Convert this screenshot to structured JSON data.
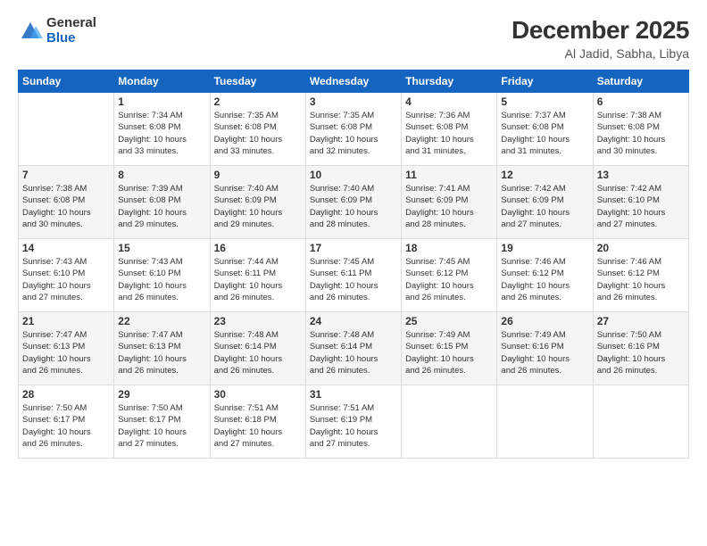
{
  "logo": {
    "general": "General",
    "blue": "Blue"
  },
  "title": {
    "month_year": "December 2025",
    "location": "Al Jadid, Sabha, Libya"
  },
  "days_of_week": [
    "Sunday",
    "Monday",
    "Tuesday",
    "Wednesday",
    "Thursday",
    "Friday",
    "Saturday"
  ],
  "weeks": [
    [
      {
        "day": "",
        "info": ""
      },
      {
        "day": "1",
        "info": "Sunrise: 7:34 AM\nSunset: 6:08 PM\nDaylight: 10 hours\nand 33 minutes."
      },
      {
        "day": "2",
        "info": "Sunrise: 7:35 AM\nSunset: 6:08 PM\nDaylight: 10 hours\nand 33 minutes."
      },
      {
        "day": "3",
        "info": "Sunrise: 7:35 AM\nSunset: 6:08 PM\nDaylight: 10 hours\nand 32 minutes."
      },
      {
        "day": "4",
        "info": "Sunrise: 7:36 AM\nSunset: 6:08 PM\nDaylight: 10 hours\nand 31 minutes."
      },
      {
        "day": "5",
        "info": "Sunrise: 7:37 AM\nSunset: 6:08 PM\nDaylight: 10 hours\nand 31 minutes."
      },
      {
        "day": "6",
        "info": "Sunrise: 7:38 AM\nSunset: 6:08 PM\nDaylight: 10 hours\nand 30 minutes."
      }
    ],
    [
      {
        "day": "7",
        "info": "Sunrise: 7:38 AM\nSunset: 6:08 PM\nDaylight: 10 hours\nand 30 minutes."
      },
      {
        "day": "8",
        "info": "Sunrise: 7:39 AM\nSunset: 6:08 PM\nDaylight: 10 hours\nand 29 minutes."
      },
      {
        "day": "9",
        "info": "Sunrise: 7:40 AM\nSunset: 6:09 PM\nDaylight: 10 hours\nand 29 minutes."
      },
      {
        "day": "10",
        "info": "Sunrise: 7:40 AM\nSunset: 6:09 PM\nDaylight: 10 hours\nand 28 minutes."
      },
      {
        "day": "11",
        "info": "Sunrise: 7:41 AM\nSunset: 6:09 PM\nDaylight: 10 hours\nand 28 minutes."
      },
      {
        "day": "12",
        "info": "Sunrise: 7:42 AM\nSunset: 6:09 PM\nDaylight: 10 hours\nand 27 minutes."
      },
      {
        "day": "13",
        "info": "Sunrise: 7:42 AM\nSunset: 6:10 PM\nDaylight: 10 hours\nand 27 minutes."
      }
    ],
    [
      {
        "day": "14",
        "info": "Sunrise: 7:43 AM\nSunset: 6:10 PM\nDaylight: 10 hours\nand 27 minutes."
      },
      {
        "day": "15",
        "info": "Sunrise: 7:43 AM\nSunset: 6:10 PM\nDaylight: 10 hours\nand 26 minutes."
      },
      {
        "day": "16",
        "info": "Sunrise: 7:44 AM\nSunset: 6:11 PM\nDaylight: 10 hours\nand 26 minutes."
      },
      {
        "day": "17",
        "info": "Sunrise: 7:45 AM\nSunset: 6:11 PM\nDaylight: 10 hours\nand 26 minutes."
      },
      {
        "day": "18",
        "info": "Sunrise: 7:45 AM\nSunset: 6:12 PM\nDaylight: 10 hours\nand 26 minutes."
      },
      {
        "day": "19",
        "info": "Sunrise: 7:46 AM\nSunset: 6:12 PM\nDaylight: 10 hours\nand 26 minutes."
      },
      {
        "day": "20",
        "info": "Sunrise: 7:46 AM\nSunset: 6:12 PM\nDaylight: 10 hours\nand 26 minutes."
      }
    ],
    [
      {
        "day": "21",
        "info": "Sunrise: 7:47 AM\nSunset: 6:13 PM\nDaylight: 10 hours\nand 26 minutes."
      },
      {
        "day": "22",
        "info": "Sunrise: 7:47 AM\nSunset: 6:13 PM\nDaylight: 10 hours\nand 26 minutes."
      },
      {
        "day": "23",
        "info": "Sunrise: 7:48 AM\nSunset: 6:14 PM\nDaylight: 10 hours\nand 26 minutes."
      },
      {
        "day": "24",
        "info": "Sunrise: 7:48 AM\nSunset: 6:14 PM\nDaylight: 10 hours\nand 26 minutes."
      },
      {
        "day": "25",
        "info": "Sunrise: 7:49 AM\nSunset: 6:15 PM\nDaylight: 10 hours\nand 26 minutes."
      },
      {
        "day": "26",
        "info": "Sunrise: 7:49 AM\nSunset: 6:16 PM\nDaylight: 10 hours\nand 26 minutes."
      },
      {
        "day": "27",
        "info": "Sunrise: 7:50 AM\nSunset: 6:16 PM\nDaylight: 10 hours\nand 26 minutes."
      }
    ],
    [
      {
        "day": "28",
        "info": "Sunrise: 7:50 AM\nSunset: 6:17 PM\nDaylight: 10 hours\nand 26 minutes."
      },
      {
        "day": "29",
        "info": "Sunrise: 7:50 AM\nSunset: 6:17 PM\nDaylight: 10 hours\nand 27 minutes."
      },
      {
        "day": "30",
        "info": "Sunrise: 7:51 AM\nSunset: 6:18 PM\nDaylight: 10 hours\nand 27 minutes."
      },
      {
        "day": "31",
        "info": "Sunrise: 7:51 AM\nSunset: 6:19 PM\nDaylight: 10 hours\nand 27 minutes."
      },
      {
        "day": "",
        "info": ""
      },
      {
        "day": "",
        "info": ""
      },
      {
        "day": "",
        "info": ""
      }
    ]
  ]
}
